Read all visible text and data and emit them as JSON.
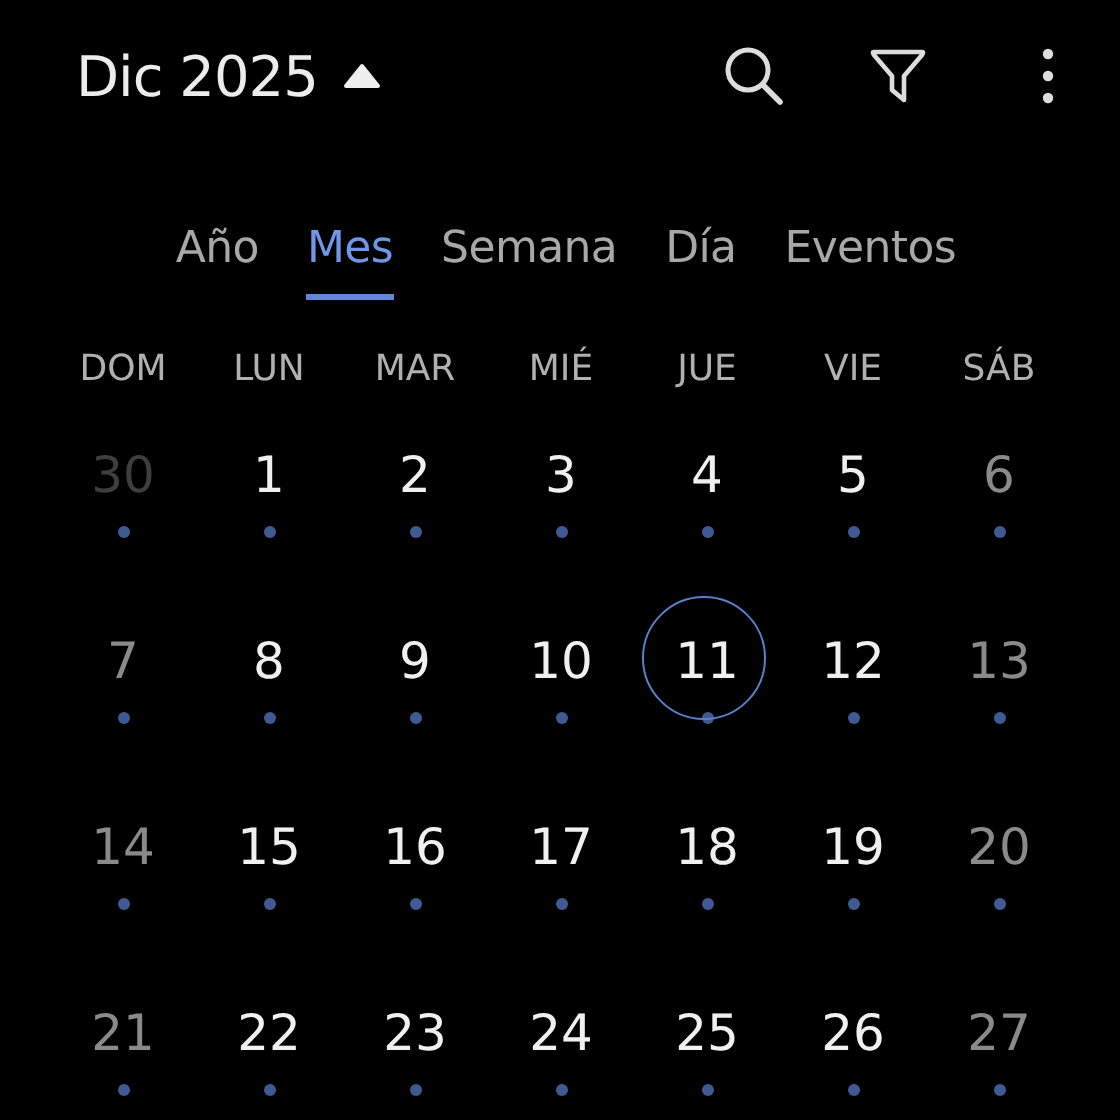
{
  "header": {
    "title": "Dic 2025",
    "picker_expanded": true
  },
  "tabs": [
    {
      "label": "Año",
      "selected": false
    },
    {
      "label": "Mes",
      "selected": true
    },
    {
      "label": "Semana",
      "selected": false
    },
    {
      "label": "Día",
      "selected": false
    },
    {
      "label": "Eventos",
      "selected": false
    }
  ],
  "weekdays": [
    "DOM",
    "LUN",
    "MAR",
    "MIÉ",
    "JUE",
    "VIE",
    "SÁB"
  ],
  "weeks": [
    [
      {
        "day": "30",
        "kind": "other",
        "today": false,
        "has_events": true
      },
      {
        "day": "1",
        "kind": "weekday",
        "today": false,
        "has_events": true
      },
      {
        "day": "2",
        "kind": "weekday",
        "today": false,
        "has_events": true
      },
      {
        "day": "3",
        "kind": "weekday",
        "today": false,
        "has_events": true
      },
      {
        "day": "4",
        "kind": "weekday",
        "today": false,
        "has_events": true
      },
      {
        "day": "5",
        "kind": "weekday",
        "today": false,
        "has_events": true
      },
      {
        "day": "6",
        "kind": "weekend",
        "today": false,
        "has_events": true
      }
    ],
    [
      {
        "day": "7",
        "kind": "weekend",
        "today": false,
        "has_events": true
      },
      {
        "day": "8",
        "kind": "weekday",
        "today": false,
        "has_events": true
      },
      {
        "day": "9",
        "kind": "weekday",
        "today": false,
        "has_events": true
      },
      {
        "day": "10",
        "kind": "weekday",
        "today": false,
        "has_events": true
      },
      {
        "day": "11",
        "kind": "weekday",
        "today": true,
        "has_events": true
      },
      {
        "day": "12",
        "kind": "weekday",
        "today": false,
        "has_events": true
      },
      {
        "day": "13",
        "kind": "weekend",
        "today": false,
        "has_events": true
      }
    ],
    [
      {
        "day": "14",
        "kind": "weekend",
        "today": false,
        "has_events": true
      },
      {
        "day": "15",
        "kind": "weekday",
        "today": false,
        "has_events": true
      },
      {
        "day": "16",
        "kind": "weekday",
        "today": false,
        "has_events": true
      },
      {
        "day": "17",
        "kind": "weekday",
        "today": false,
        "has_events": true
      },
      {
        "day": "18",
        "kind": "weekday",
        "today": false,
        "has_events": true
      },
      {
        "day": "19",
        "kind": "weekday",
        "today": false,
        "has_events": true
      },
      {
        "day": "20",
        "kind": "weekend",
        "today": false,
        "has_events": true
      }
    ],
    [
      {
        "day": "21",
        "kind": "weekend",
        "today": false,
        "has_events": true
      },
      {
        "day": "22",
        "kind": "weekday",
        "today": false,
        "has_events": true
      },
      {
        "day": "23",
        "kind": "weekday",
        "today": false,
        "has_events": true
      },
      {
        "day": "24",
        "kind": "weekday",
        "today": false,
        "has_events": true
      },
      {
        "day": "25",
        "kind": "weekday",
        "today": false,
        "has_events": true
      },
      {
        "day": "26",
        "kind": "weekday",
        "today": false,
        "has_events": true
      },
      {
        "day": "27",
        "kind": "weekend",
        "today": false,
        "has_events": true
      }
    ]
  ]
}
